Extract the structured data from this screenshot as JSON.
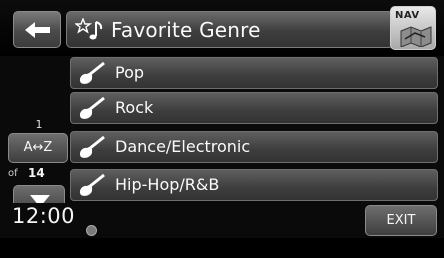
{
  "header": {
    "back_icon": "left-arrow-icon",
    "title_icon": "music-note-star-icon",
    "title": "Favorite Genre",
    "nav_label": "NAV",
    "nav_icon": "map-icon"
  },
  "left_panel": {
    "position": "1",
    "sort_label": "A↔Z",
    "of_label": "of",
    "total": "14",
    "down_icon": "down-arrow-icon"
  },
  "genres": [
    {
      "label": "Pop",
      "icon": "guitar-icon"
    },
    {
      "label": "Rock",
      "icon": "guitar-icon"
    },
    {
      "label": "Dance/Electronic",
      "icon": "guitar-icon"
    },
    {
      "label": "Hip-Hop/R&B",
      "icon": "guitar-icon"
    }
  ],
  "footer": {
    "time": "12:00",
    "exit_label": "EXIT"
  }
}
